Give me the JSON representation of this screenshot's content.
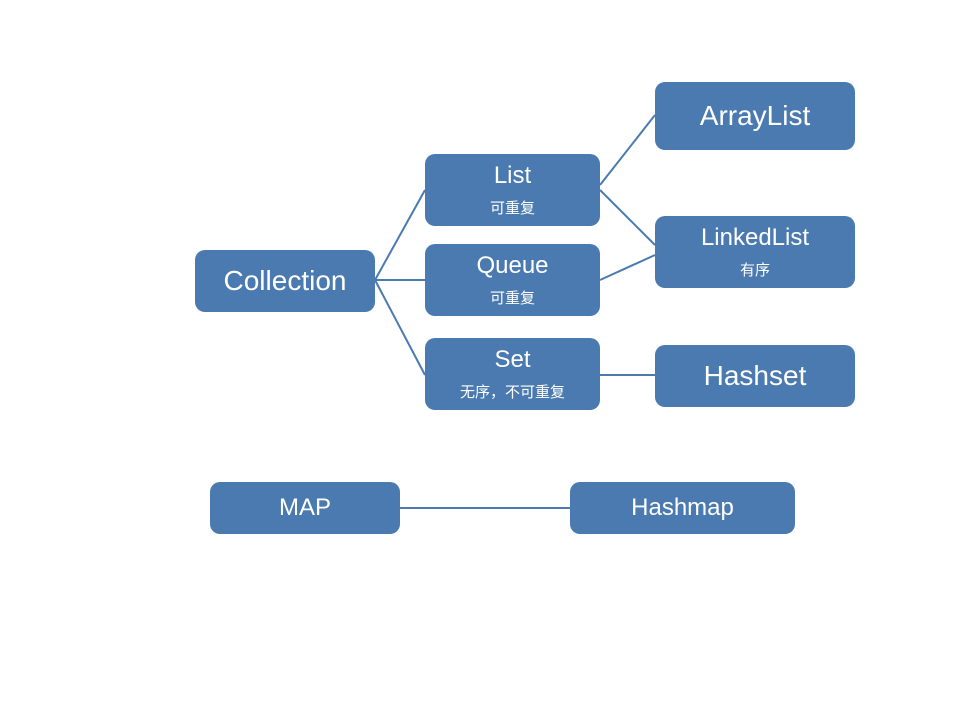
{
  "nodes": {
    "collection": {
      "title": "Collection"
    },
    "list": {
      "title": "List",
      "sub": "可重复"
    },
    "queue": {
      "title": "Queue",
      "sub": "可重复"
    },
    "set": {
      "title": "Set",
      "sub": "无序，不可重复"
    },
    "arraylist": {
      "title": "ArrayList"
    },
    "linkedlist": {
      "title": "LinkedList",
      "sub": "有序"
    },
    "hashset": {
      "title": "Hashset"
    },
    "map": {
      "title": "MAP"
    },
    "hashmap": {
      "title": "Hashmap"
    }
  }
}
